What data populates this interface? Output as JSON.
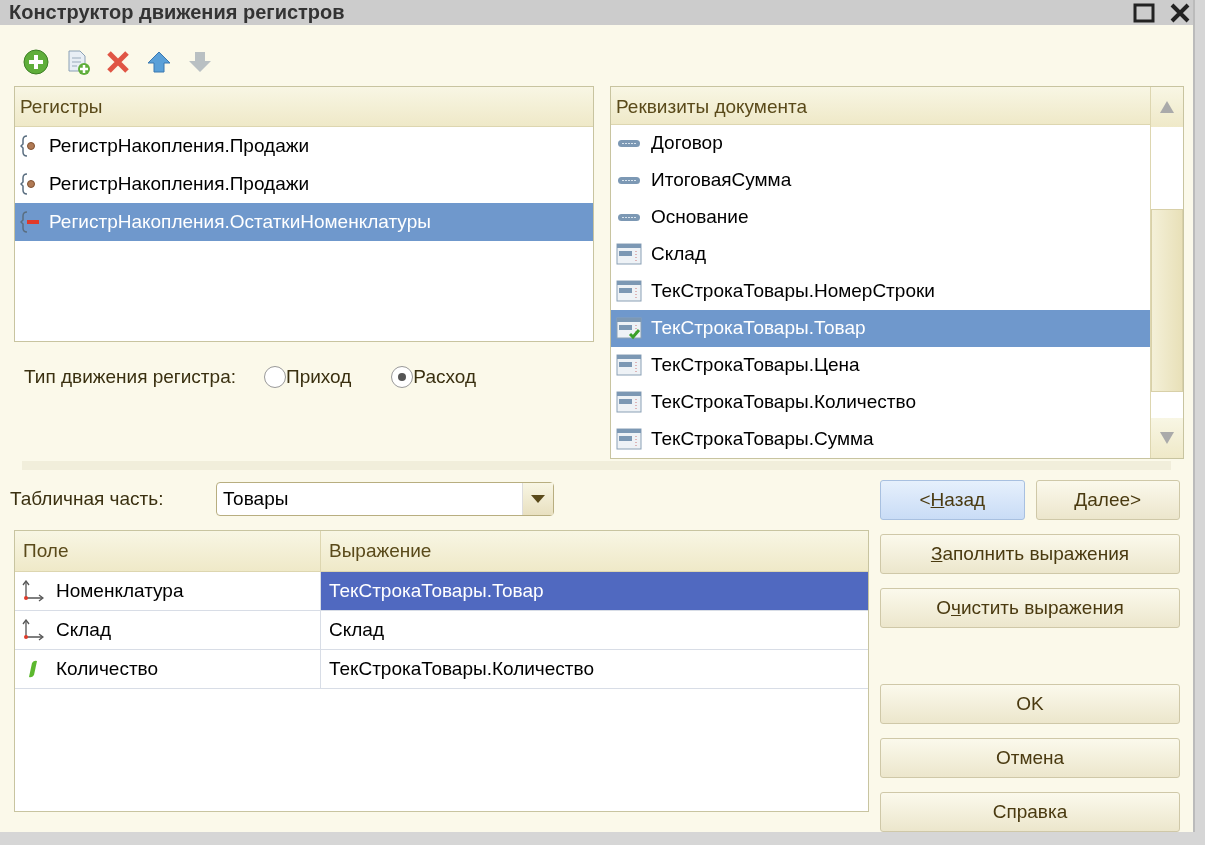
{
  "window": {
    "title": "Конструктор движения регистров"
  },
  "toolbar": [
    {
      "kind": "add",
      "disabled": false
    },
    {
      "kind": "copy",
      "disabled": false
    },
    {
      "kind": "delete",
      "disabled": false
    },
    {
      "kind": "up",
      "disabled": false
    },
    {
      "kind": "down",
      "disabled": true
    }
  ],
  "registers": {
    "header": "Регистры",
    "items": [
      {
        "label": "РегистрНакопления.Продажи",
        "kind": "turnover",
        "selected": false
      },
      {
        "label": "РегистрНакопления.Продажи",
        "kind": "turnover",
        "selected": false
      },
      {
        "label": "РегистрНакопления.ОстаткиНоменклатуры",
        "kind": "expense",
        "selected": true
      }
    ]
  },
  "movement_type": {
    "label": "Тип движения регистра:",
    "options": [
      {
        "label": "Приход",
        "selected": false
      },
      {
        "label": "Расход",
        "selected": true
      }
    ]
  },
  "document_attributes": {
    "header": "Реквизиты документа",
    "items": [
      {
        "label": "Договор",
        "kind": "attribute",
        "used": false,
        "selected": false
      },
      {
        "label": "ИтоговаяСумма",
        "kind": "attribute",
        "used": false,
        "selected": false
      },
      {
        "label": "Основание",
        "kind": "attribute",
        "used": false,
        "selected": false
      },
      {
        "label": "Склад",
        "kind": "table",
        "used": false,
        "selected": false
      },
      {
        "label": "ТекСтрокаТовары.НомерСтроки",
        "kind": "table",
        "used": false,
        "selected": false
      },
      {
        "label": "ТекСтрокаТовары.Товар",
        "kind": "table",
        "used": true,
        "selected": true
      },
      {
        "label": "ТекСтрокаТовары.Цена",
        "kind": "table",
        "used": false,
        "selected": false
      },
      {
        "label": "ТекСтрокаТовары.Количество",
        "kind": "table",
        "used": false,
        "selected": false
      },
      {
        "label": "ТекСтрокаТовары.Сумма",
        "kind": "table",
        "used": false,
        "selected": false
      }
    ]
  },
  "tabular_section": {
    "label": "Табличная часть:",
    "value": "Товары"
  },
  "fields_table": {
    "columns": [
      "Поле",
      "Выражение"
    ],
    "rows": [
      {
        "kind": "dimension",
        "field": "Номенклатура",
        "expression": "ТекСтрокаТовары.Товар",
        "selected": true
      },
      {
        "kind": "dimension",
        "field": "Склад",
        "expression": "Склад",
        "selected": false
      },
      {
        "kind": "resource",
        "field": "Количество",
        "expression": "ТекСтрокаТовары.Количество",
        "selected": false
      }
    ]
  },
  "buttons": [
    {
      "pre": "<",
      "key": "Н",
      "post": "азад",
      "kind": "nav",
      "focused": true
    },
    {
      "key": "Д",
      "post": "алее>",
      "kind": "nav",
      "focused": false
    },
    {
      "key": "З",
      "post": "аполнить выражения",
      "kind": "wide",
      "focused": false
    },
    {
      "pre": "О",
      "key": "ч",
      "post": "истить выражения",
      "kind": "wide",
      "focused": false
    },
    {
      "pre": "OK",
      "kind": "spaced",
      "focused": false
    },
    {
      "pre": "Отмена",
      "kind": "wide",
      "focused": false
    },
    {
      "pre": "Справка",
      "kind": "wide",
      "focused": false
    }
  ]
}
